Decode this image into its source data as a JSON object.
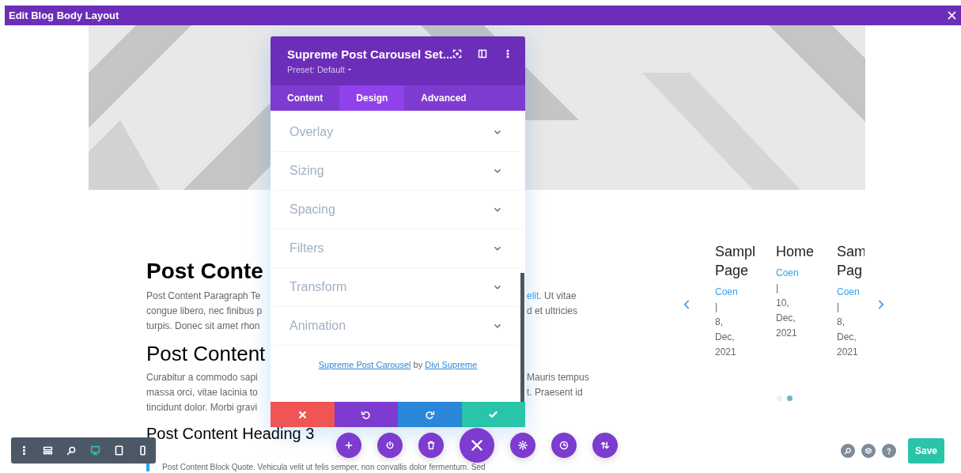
{
  "window": {
    "title": "Edit Blog Body Layout"
  },
  "post_content": {
    "heading_1": "Post Conte",
    "paragraph_1": {
      "left_lines": [
        "Post Content Paragraph Te",
        "congue libero, nec finibus p",
        "turpis. Donec sit amet rhon"
      ],
      "right_lines": [
        [
          {
            "text": "elit",
            "link": true
          },
          {
            "text": ". Ut vitae",
            "link": false
          }
        ],
        [
          {
            "text": "d et ultricies",
            "link": false
          }
        ]
      ]
    },
    "heading_2": "Post Content",
    "paragraph_2": {
      "left_lines": [
        "Curabitur a commodo sapi",
        "massa orci, vitae lacinia to",
        "tincidunt dolor. Morbi gravi"
      ],
      "right_lines": [
        [
          {
            "text": "Mauris tempus",
            "link": false
          }
        ],
        [
          {
            "text": "t. Praesent id",
            "link": false
          }
        ]
      ]
    },
    "heading_3": "Post Content Heading 3",
    "block_quote": "Post Content Block Quote. Vehicula velit ut felis semper, non convallis dolor fermentum. Sed"
  },
  "carousel": {
    "posts": [
      {
        "title_lines": [
          "Sampl",
          "Page"
        ],
        "author": "Coen",
        "meta_lines": [
          "|",
          "8,",
          "Dec,",
          "2021"
        ]
      },
      {
        "title_lines": [
          "Home"
        ],
        "author": "Coen",
        "meta_lines": [
          "|",
          "10,",
          "Dec,",
          "2021"
        ]
      },
      {
        "title_lines": [
          "Sam",
          "Pag"
        ],
        "author": "Coen",
        "meta_lines": [
          "|",
          "8,",
          "Dec,",
          "2021"
        ]
      }
    ],
    "dots": [
      {
        "selected": false
      },
      {
        "selected": true
      }
    ]
  },
  "settings_modal": {
    "title": "Supreme Post Carousel Set...",
    "preset": "Preset: Default",
    "tabs": [
      {
        "label": "Content",
        "selected": false
      },
      {
        "label": "Design",
        "selected": true
      },
      {
        "label": "Advanced",
        "selected": false
      }
    ],
    "sections": [
      {
        "label": "Overlay"
      },
      {
        "label": "Sizing"
      },
      {
        "label": "Spacing"
      },
      {
        "label": "Filters"
      },
      {
        "label": "Transform"
      },
      {
        "label": "Animation"
      }
    ],
    "credit": [
      {
        "text": "Supreme Post Carousel",
        "link": true
      },
      {
        "text": " by ",
        "link": false
      },
      {
        "text": "Divi Supreme",
        "link": true
      }
    ],
    "actions": [
      {
        "kind": "cancel"
      },
      {
        "kind": "undo"
      },
      {
        "kind": "redo"
      },
      {
        "kind": "save"
      }
    ]
  },
  "view_toolbar": [
    {
      "kind": "menu",
      "selected": false
    },
    {
      "kind": "wireframe",
      "selected": false
    },
    {
      "kind": "zoom",
      "selected": false
    },
    {
      "kind": "desktop",
      "selected": true
    },
    {
      "kind": "tablet",
      "selected": false
    },
    {
      "kind": "phone",
      "selected": false
    }
  ],
  "builder_actions": [
    {
      "kind": "add"
    },
    {
      "kind": "portability"
    },
    {
      "kind": "clear"
    },
    {
      "kind": "close"
    },
    {
      "kind": "settings"
    },
    {
      "kind": "history"
    },
    {
      "kind": "sort"
    }
  ],
  "help_tools": [
    {
      "kind": "search"
    },
    {
      "kind": "layers"
    },
    {
      "kind": "help"
    }
  ],
  "save_button": "Save"
}
